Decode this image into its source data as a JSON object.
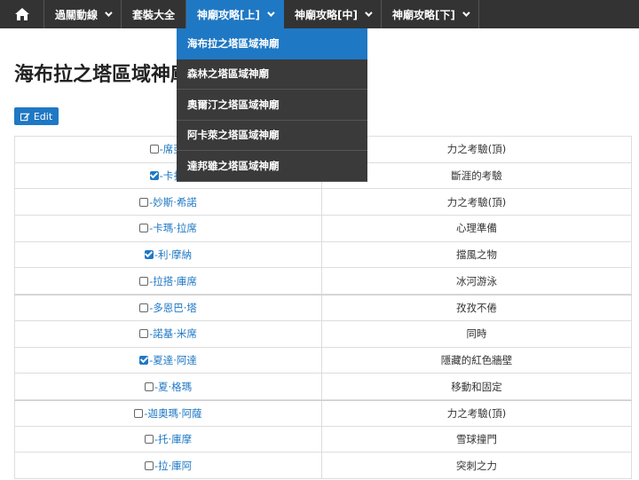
{
  "navbar": {
    "items": [
      {
        "label": "過關動線",
        "dropdown": true
      },
      {
        "label": "套裝大全",
        "dropdown": false
      },
      {
        "label": "神廟攻略[上]",
        "dropdown": true,
        "active": true
      },
      {
        "label": "神廟攻略[中]",
        "dropdown": true
      },
      {
        "label": "神廟攻略[下]",
        "dropdown": true
      }
    ]
  },
  "dropdown": {
    "items": [
      {
        "label": "海布拉之塔區域神廟",
        "active": true
      },
      {
        "label": "森林之塔區域神廟"
      },
      {
        "label": "奧爾汀之塔區域神廟"
      },
      {
        "label": "阿卡萊之塔區域神廟"
      },
      {
        "label": "達邦雖之塔區域神廟"
      }
    ]
  },
  "page": {
    "title": "海布拉之塔區域神廟",
    "edit_label": "Edit"
  },
  "table": {
    "rows": [
      {
        "name": "-席亞·",
        "trial": "力之考驗(頂)",
        "checked": false
      },
      {
        "name": "-卡扎·",
        "trial": "斷涯的考驗",
        "checked": true
      },
      {
        "name": "-妙斯·希諾",
        "trial": "力之考驗(頂)",
        "checked": false
      },
      {
        "name": "-卡瑪·拉席",
        "trial": "心理準備",
        "checked": false
      },
      {
        "name": "-利·摩納",
        "trial": "擋風之物",
        "checked": true
      },
      {
        "name": "-拉搭·庫席",
        "trial": "冰河游泳",
        "checked": false
      },
      {
        "name": "-多恩巴·塔",
        "trial": "孜孜不倦",
        "checked": false
      },
      {
        "name": "-諾基·米席",
        "trial": "同時",
        "checked": false
      },
      {
        "name": "-夏達·阿達",
        "trial": "隱藏的紅色牆壁",
        "checked": true
      },
      {
        "name": "-夏·格瑪",
        "trial": "移動和固定",
        "checked": false
      },
      {
        "name": "-迦奧瑪·阿薩",
        "trial": "力之考驗(頂)",
        "checked": false
      },
      {
        "name": "-托·庫摩",
        "trial": "雪球撞門",
        "checked": false
      },
      {
        "name": "-拉·庫阿",
        "trial": "突刺之力",
        "checked": false
      }
    ]
  },
  "colors": {
    "accent": "#1f78c4",
    "navbar_bg": "#333333"
  }
}
